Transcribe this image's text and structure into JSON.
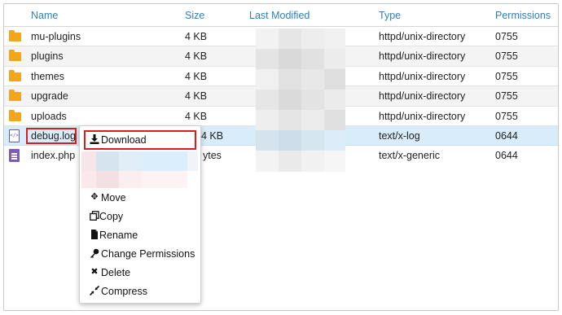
{
  "headers": {
    "name": "Name",
    "size": "Size",
    "last_modified": "Last Modified",
    "type": "Type",
    "permissions": "Permissions"
  },
  "rows": [
    {
      "name": "mu-plugins",
      "size": "4 KB",
      "type": "httpd/unix-directory",
      "perm": "0755",
      "icon": "folder-icon"
    },
    {
      "name": "plugins",
      "size": "4 KB",
      "type": "httpd/unix-directory",
      "perm": "0755",
      "icon": "folder-icon"
    },
    {
      "name": "themes",
      "size": "4 KB",
      "type": "httpd/unix-directory",
      "perm": "0755",
      "icon": "folder-icon"
    },
    {
      "name": "upgrade",
      "size": "4 KB",
      "type": "httpd/unix-directory",
      "perm": "0755",
      "icon": "folder-icon"
    },
    {
      "name": "uploads",
      "size": "4 KB",
      "type": "httpd/unix-directory",
      "perm": "0755",
      "icon": "folder-icon"
    },
    {
      "name": "debug.log",
      "size": "4 KB",
      "type": "text/x-log",
      "perm": "0644",
      "icon": "log-file-icon"
    },
    {
      "name": "index.php",
      "size": "ytes",
      "type": "text/x-generic",
      "perm": "0644",
      "icon": "php-file-icon"
    }
  ],
  "context_menu": {
    "download": "Download",
    "move": "Move",
    "copy": "Copy",
    "rename": "Rename",
    "change_permissions": "Change Permissions",
    "delete": "Delete",
    "compress": "Compress"
  },
  "colors": {
    "header_text": "#2f7fbf",
    "folder": "#f3a61c",
    "selected_row": "#d9ecf9",
    "highlight_box": "#d81e1e"
  }
}
